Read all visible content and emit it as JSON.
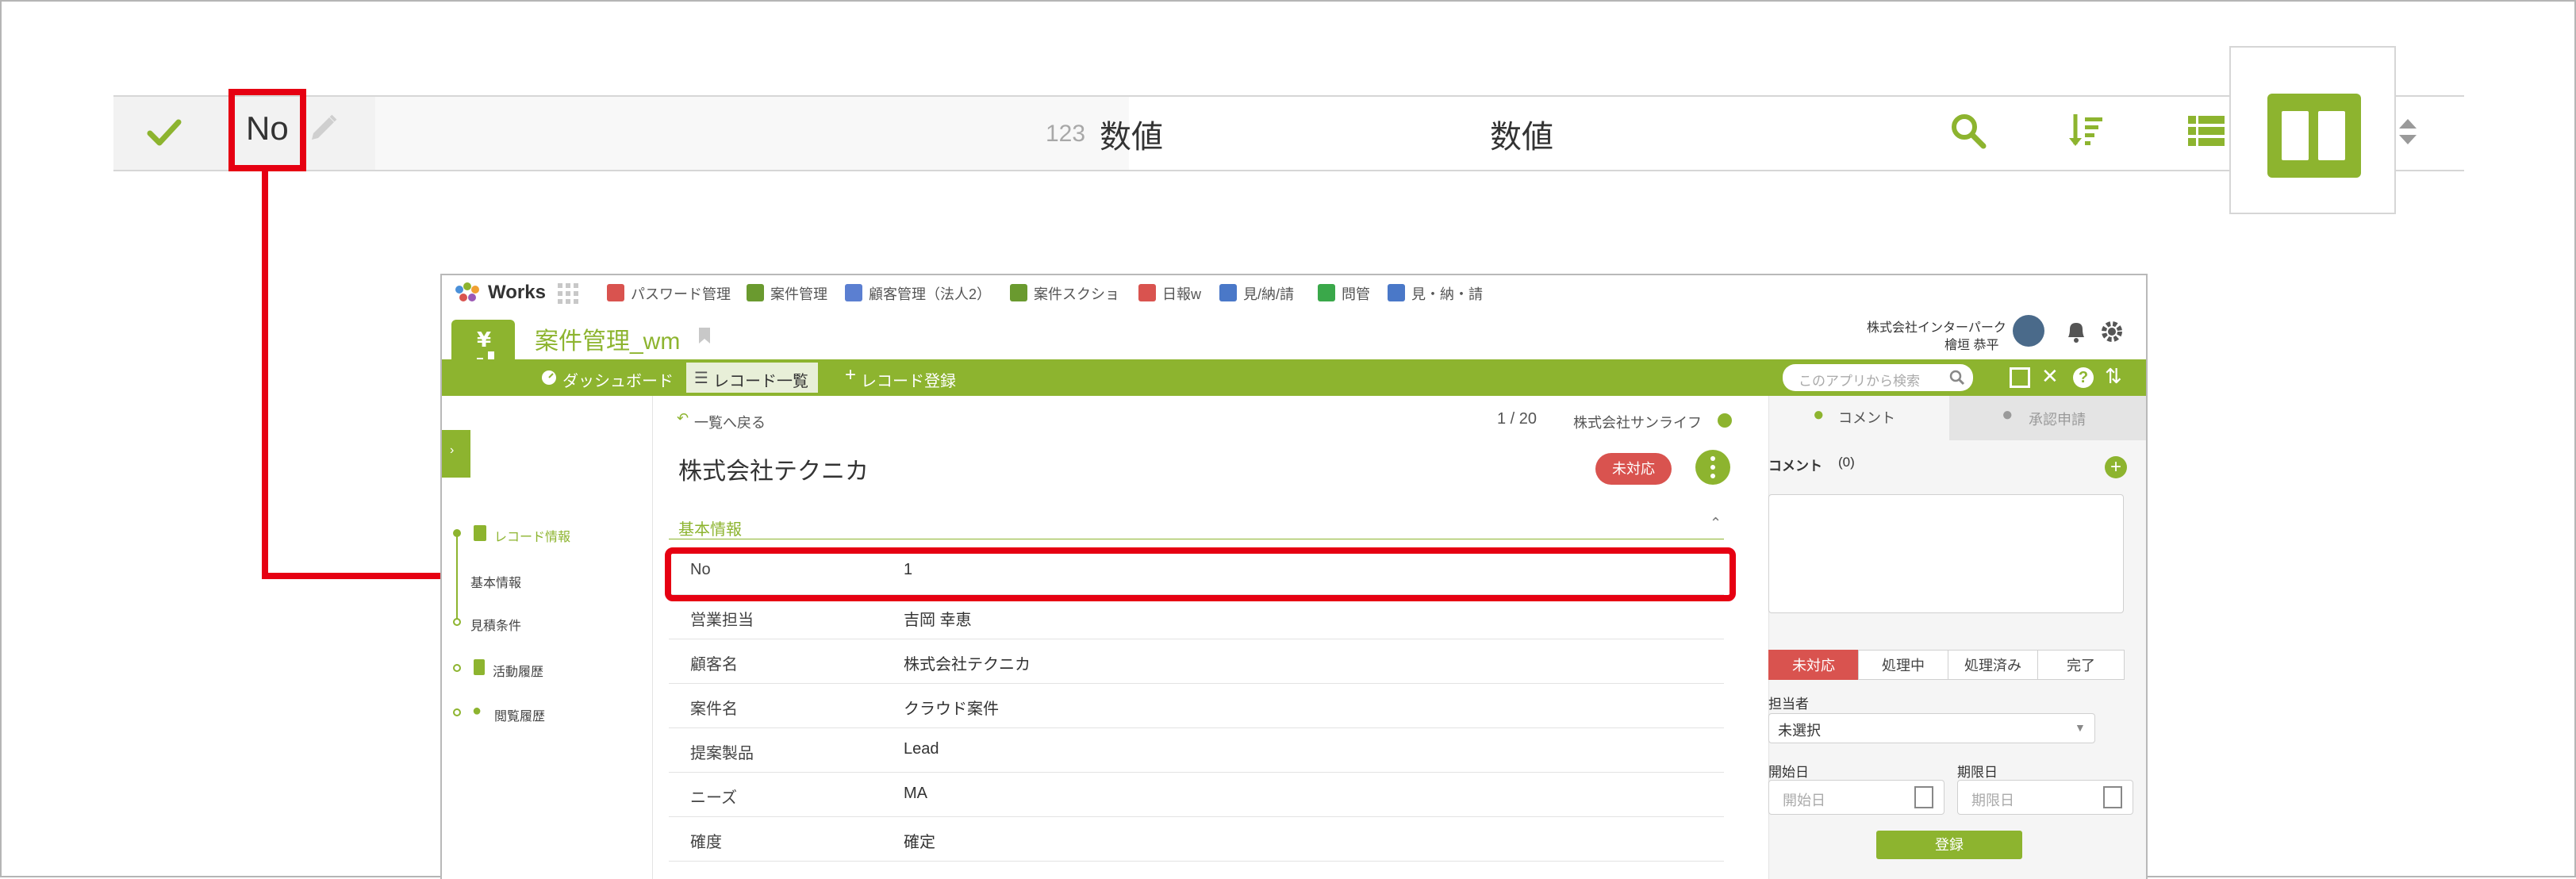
{
  "toolbar": {
    "field_name": "No",
    "type_icon": "123",
    "type_label": "数値",
    "field_type_center": "数値",
    "icons": [
      "check-icon",
      "pencil-icon",
      "search-icon",
      "sort-icon",
      "list-icon",
      "two-column-icon",
      "up-down-icon"
    ],
    "accent": "#8db42f"
  },
  "app": {
    "logo": "Works",
    "nav": [
      "パスワード管理",
      "案件管理",
      "顧客管理（法人2）",
      "案件スクショ",
      "日報w",
      "見/納/請",
      "問管",
      "見・納・請"
    ],
    "company": "株式会社インターパーク",
    "user": "檜垣 恭平",
    "app_title": "案件管理_wm",
    "tabs": {
      "dashboard": "ダッシュボード",
      "record_list": "レコード一覧",
      "record_add": "レコード登録"
    },
    "search_placeholder": "このアプリから検索",
    "back": "一覧へ戻る",
    "pager": "1 / 20",
    "next_record": "株式会社サンライフ",
    "record_title": "株式会社テクニカ",
    "status_badge": "未対応",
    "section": "基本情報",
    "sidebar": [
      "レコード情報",
      "基本情報",
      "見積条件",
      "活動履歴",
      "閲覧履歴"
    ],
    "fields": [
      {
        "label": "No",
        "value": "1"
      },
      {
        "label": "営業担当",
        "value": "吉岡 幸恵"
      },
      {
        "label": "顧客名",
        "value": "株式会社テクニカ"
      },
      {
        "label": "案件名",
        "value": "クラウド案件"
      },
      {
        "label": "提案製品",
        "value": "Lead"
      },
      {
        "label": "ニーズ",
        "value": "MA"
      },
      {
        "label": "確度",
        "value": "確定"
      }
    ],
    "right": {
      "tab_comment": "コメント",
      "tab_approval": "承認申請",
      "comment_label": "コメント",
      "comment_count": "(0)",
      "statuses": [
        "未対応",
        "処理中",
        "処理済み",
        "完了"
      ],
      "assignee_label": "担当者",
      "assignee_value": "未選択",
      "start_label": "開始日",
      "start_placeholder": "開始日",
      "end_label": "期限日",
      "end_placeholder": "期限日",
      "submit": "登録"
    },
    "colors": {
      "green": "#8db42f",
      "status_red": "#d9534f"
    }
  }
}
